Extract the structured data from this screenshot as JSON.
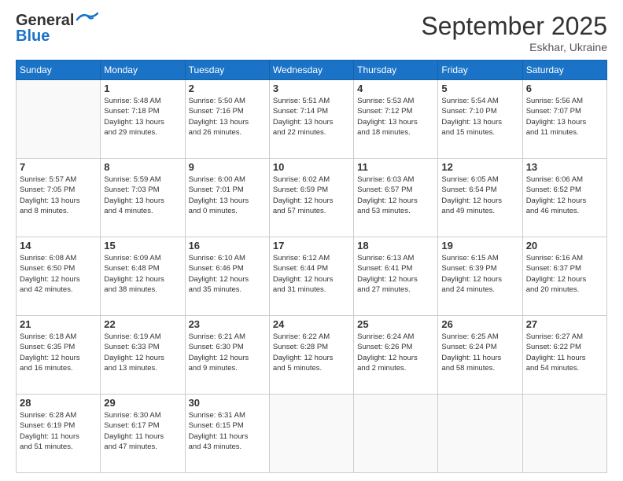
{
  "logo": {
    "line1": "General",
    "line2": "Blue"
  },
  "title": "September 2025",
  "subtitle": "Eskhar, Ukraine",
  "headers": [
    "Sunday",
    "Monday",
    "Tuesday",
    "Wednesday",
    "Thursday",
    "Friday",
    "Saturday"
  ],
  "weeks": [
    [
      {
        "day": "",
        "info": ""
      },
      {
        "day": "1",
        "info": "Sunrise: 5:48 AM\nSunset: 7:18 PM\nDaylight: 13 hours\nand 29 minutes."
      },
      {
        "day": "2",
        "info": "Sunrise: 5:50 AM\nSunset: 7:16 PM\nDaylight: 13 hours\nand 26 minutes."
      },
      {
        "day": "3",
        "info": "Sunrise: 5:51 AM\nSunset: 7:14 PM\nDaylight: 13 hours\nand 22 minutes."
      },
      {
        "day": "4",
        "info": "Sunrise: 5:53 AM\nSunset: 7:12 PM\nDaylight: 13 hours\nand 18 minutes."
      },
      {
        "day": "5",
        "info": "Sunrise: 5:54 AM\nSunset: 7:10 PM\nDaylight: 13 hours\nand 15 minutes."
      },
      {
        "day": "6",
        "info": "Sunrise: 5:56 AM\nSunset: 7:07 PM\nDaylight: 13 hours\nand 11 minutes."
      }
    ],
    [
      {
        "day": "7",
        "info": "Sunrise: 5:57 AM\nSunset: 7:05 PM\nDaylight: 13 hours\nand 8 minutes."
      },
      {
        "day": "8",
        "info": "Sunrise: 5:59 AM\nSunset: 7:03 PM\nDaylight: 13 hours\nand 4 minutes."
      },
      {
        "day": "9",
        "info": "Sunrise: 6:00 AM\nSunset: 7:01 PM\nDaylight: 13 hours\nand 0 minutes."
      },
      {
        "day": "10",
        "info": "Sunrise: 6:02 AM\nSunset: 6:59 PM\nDaylight: 12 hours\nand 57 minutes."
      },
      {
        "day": "11",
        "info": "Sunrise: 6:03 AM\nSunset: 6:57 PM\nDaylight: 12 hours\nand 53 minutes."
      },
      {
        "day": "12",
        "info": "Sunrise: 6:05 AM\nSunset: 6:54 PM\nDaylight: 12 hours\nand 49 minutes."
      },
      {
        "day": "13",
        "info": "Sunrise: 6:06 AM\nSunset: 6:52 PM\nDaylight: 12 hours\nand 46 minutes."
      }
    ],
    [
      {
        "day": "14",
        "info": "Sunrise: 6:08 AM\nSunset: 6:50 PM\nDaylight: 12 hours\nand 42 minutes."
      },
      {
        "day": "15",
        "info": "Sunrise: 6:09 AM\nSunset: 6:48 PM\nDaylight: 12 hours\nand 38 minutes."
      },
      {
        "day": "16",
        "info": "Sunrise: 6:10 AM\nSunset: 6:46 PM\nDaylight: 12 hours\nand 35 minutes."
      },
      {
        "day": "17",
        "info": "Sunrise: 6:12 AM\nSunset: 6:44 PM\nDaylight: 12 hours\nand 31 minutes."
      },
      {
        "day": "18",
        "info": "Sunrise: 6:13 AM\nSunset: 6:41 PM\nDaylight: 12 hours\nand 27 minutes."
      },
      {
        "day": "19",
        "info": "Sunrise: 6:15 AM\nSunset: 6:39 PM\nDaylight: 12 hours\nand 24 minutes."
      },
      {
        "day": "20",
        "info": "Sunrise: 6:16 AM\nSunset: 6:37 PM\nDaylight: 12 hours\nand 20 minutes."
      }
    ],
    [
      {
        "day": "21",
        "info": "Sunrise: 6:18 AM\nSunset: 6:35 PM\nDaylight: 12 hours\nand 16 minutes."
      },
      {
        "day": "22",
        "info": "Sunrise: 6:19 AM\nSunset: 6:33 PM\nDaylight: 12 hours\nand 13 minutes."
      },
      {
        "day": "23",
        "info": "Sunrise: 6:21 AM\nSunset: 6:30 PM\nDaylight: 12 hours\nand 9 minutes."
      },
      {
        "day": "24",
        "info": "Sunrise: 6:22 AM\nSunset: 6:28 PM\nDaylight: 12 hours\nand 5 minutes."
      },
      {
        "day": "25",
        "info": "Sunrise: 6:24 AM\nSunset: 6:26 PM\nDaylight: 12 hours\nand 2 minutes."
      },
      {
        "day": "26",
        "info": "Sunrise: 6:25 AM\nSunset: 6:24 PM\nDaylight: 11 hours\nand 58 minutes."
      },
      {
        "day": "27",
        "info": "Sunrise: 6:27 AM\nSunset: 6:22 PM\nDaylight: 11 hours\nand 54 minutes."
      }
    ],
    [
      {
        "day": "28",
        "info": "Sunrise: 6:28 AM\nSunset: 6:19 PM\nDaylight: 11 hours\nand 51 minutes."
      },
      {
        "day": "29",
        "info": "Sunrise: 6:30 AM\nSunset: 6:17 PM\nDaylight: 11 hours\nand 47 minutes."
      },
      {
        "day": "30",
        "info": "Sunrise: 6:31 AM\nSunset: 6:15 PM\nDaylight: 11 hours\nand 43 minutes."
      },
      {
        "day": "",
        "info": ""
      },
      {
        "day": "",
        "info": ""
      },
      {
        "day": "",
        "info": ""
      },
      {
        "day": "",
        "info": ""
      }
    ]
  ]
}
